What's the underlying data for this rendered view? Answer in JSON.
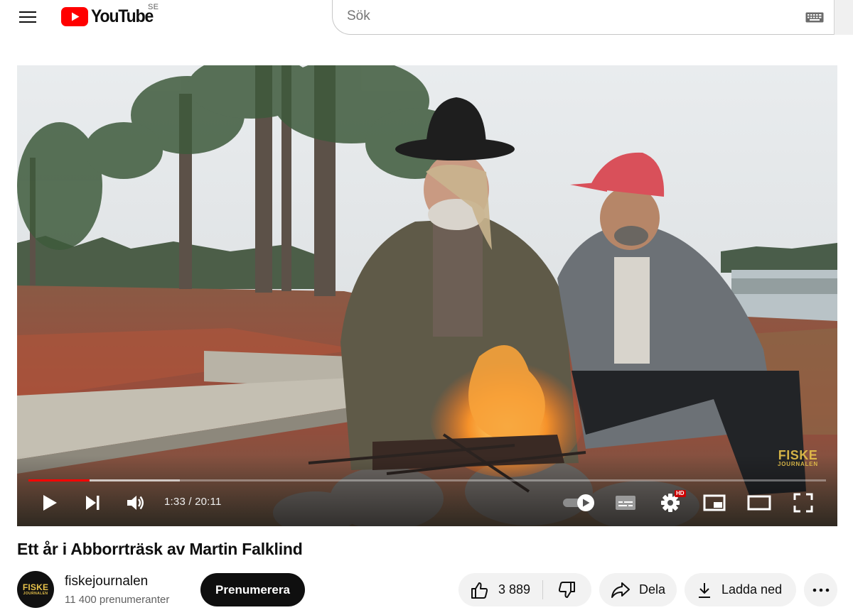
{
  "header": {
    "logo_text": "YouTube",
    "country_code": "SE",
    "search_placeholder": "Sök"
  },
  "player": {
    "current_time": "1:33",
    "duration": "20:11",
    "time_display": "1:33 / 20:11",
    "played_fraction": 0.077,
    "buffered_fraction": 0.19,
    "watermark_line1": "FISKE",
    "watermark_line2": "JOURNALEN",
    "hd_badge": "HD",
    "autoplay_on": true
  },
  "video": {
    "title": "Ett år i Abborrträsk av Martin Falklind"
  },
  "channel": {
    "name": "fiskejournalen",
    "subscribers": "11 400 prenumeranter",
    "avatar_line1": "FISKE",
    "avatar_line2": "JOURNALEN",
    "subscribe_label": "Prenumerera"
  },
  "actions": {
    "like_count": "3 889",
    "share_label": "Dela",
    "download_label": "Ladda ned"
  },
  "colors": {
    "brand_red": "#ff0000",
    "button_dark": "#0f0f0f",
    "pill_bg": "#f2f2f2",
    "watermark_gold": "#e7c24a"
  }
}
